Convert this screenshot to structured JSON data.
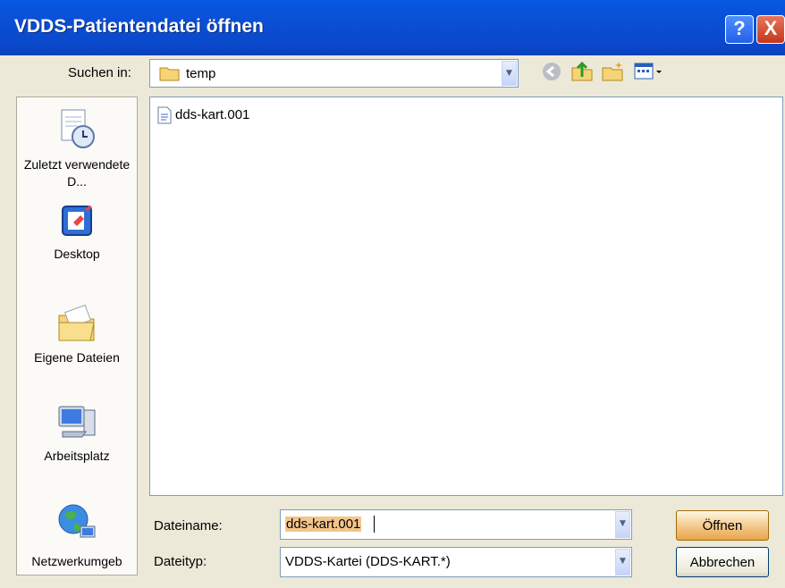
{
  "window": {
    "title": "VDDS-Patientendatei öffnen",
    "help_label": "?",
    "close_label": "X"
  },
  "toolbar": {
    "look_in_label": "Suchen in:",
    "look_in_value": "temp",
    "tools": [
      "back-icon",
      "up-folder-icon",
      "new-folder-icon",
      "view-menu-icon"
    ]
  },
  "places": [
    {
      "label": "Zuletzt verwendete D...",
      "icon": "recent-documents-icon"
    },
    {
      "label": "Desktop",
      "icon": "desktop-icon"
    },
    {
      "label": "Eigene Dateien",
      "icon": "my-documents-icon"
    },
    {
      "label": "Arbeitsplatz",
      "icon": "my-computer-icon"
    },
    {
      "label": "Netzwerkumgeb",
      "icon": "network-icon"
    }
  ],
  "files": [
    {
      "name": "dds-kart.001",
      "icon": "file-icon"
    }
  ],
  "filename": {
    "label": "Dateiname:",
    "value": "dds-kart.001"
  },
  "filetype": {
    "label": "Dateityp:",
    "value": "VDDS-Kartei (DDS-KART.*)"
  },
  "buttons": {
    "open": "Öffnen",
    "cancel": "Abbrechen"
  },
  "colors": {
    "titlebar": "#0a4fd6",
    "dialog_bg": "#ece9d8",
    "default_button": "#f3c78a"
  }
}
